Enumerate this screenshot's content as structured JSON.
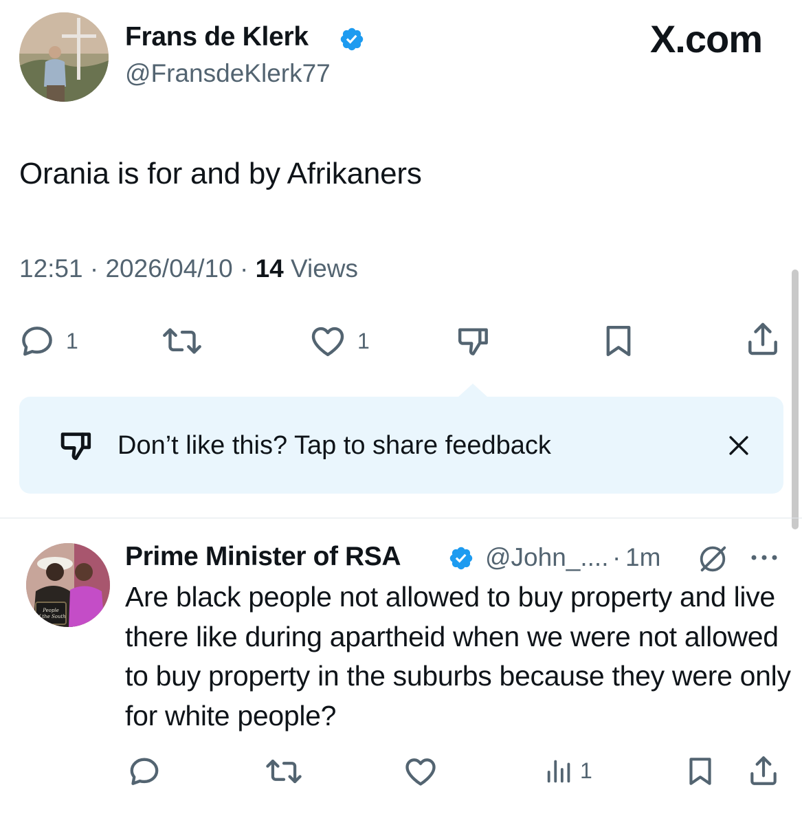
{
  "tweet": {
    "author_name": "Frans de Klerk",
    "author_handle": "@FransdeKlerk77",
    "brand": "X.com",
    "text": "Orania is for and by Afrikaners",
    "time": "12:51",
    "date": "2026/04/10",
    "views_count": "14",
    "views_label": "Views",
    "replies": "1",
    "likes": "1"
  },
  "feedback_banner": {
    "text": "Don’t like this? Tap to share feedback"
  },
  "reply": {
    "author_name": "Prime Minister of RSA",
    "author_handle": "@John_....",
    "time": "1m",
    "text": "Are black people not allowed to buy property and live there like during apartheid when we were not allowed to buy property in the suburbs because they were only for white people?",
    "views": "1",
    "avatar_caption": "People of the South"
  },
  "colors": {
    "text_primary": "#0f1419",
    "text_secondary": "#536471",
    "verified_blue": "#1d9bf0",
    "banner_background": "#eaf6fd",
    "divider": "#e1e6ea"
  },
  "icons": {
    "reply": "speech-bubble-icon",
    "repost": "repost-icon",
    "like": "heart-icon",
    "dislike": "thumbs-down-icon",
    "bookmark": "bookmark-icon",
    "share": "share-icon",
    "close": "close-icon",
    "grok": "grok-icon",
    "more": "more-dots-icon",
    "views": "analytics-bars-icon"
  }
}
